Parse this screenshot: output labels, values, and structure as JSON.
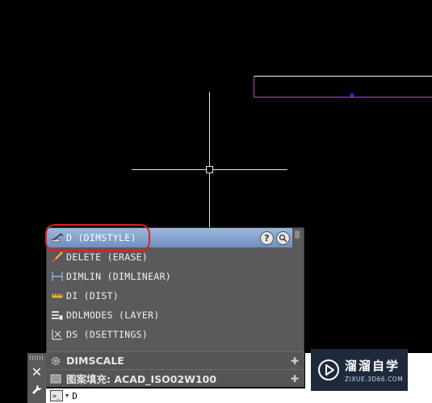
{
  "autocomplete": {
    "items": [
      {
        "label": "D (DIMSTYLE)",
        "icon": "dimstyle-icon",
        "selected": true
      },
      {
        "label": "DELETE (ERASE)",
        "icon": "erase-icon",
        "selected": false
      },
      {
        "label": "DIMLIN (DIMLINEAR)",
        "icon": "dimlinear-icon",
        "selected": false
      },
      {
        "label": "DI (DIST)",
        "icon": "dist-icon",
        "selected": false
      },
      {
        "label": "DDLMODES (LAYER)",
        "icon": "layer-icon",
        "selected": false
      },
      {
        "label": "DS (DSETTINGS)",
        "icon": "dsettings-icon",
        "selected": false
      }
    ],
    "help_icon": "?",
    "highlight_color": "#e02020",
    "selected_color": "#7f9dc8"
  },
  "command_history": [
    {
      "label": "DIMSCALE",
      "icon": "gear-icon"
    },
    {
      "label": "图案填充: ACAD_ISO02W100",
      "icon": "hatch-icon"
    }
  ],
  "command_input": {
    "value": "D"
  },
  "watermark": {
    "main": "溜溜自学",
    "sub": "ZIXUE.3D66.COM"
  },
  "colors": {
    "background": "#000000",
    "magenta": "#c040c0",
    "panel": "#5a5a5a"
  }
}
